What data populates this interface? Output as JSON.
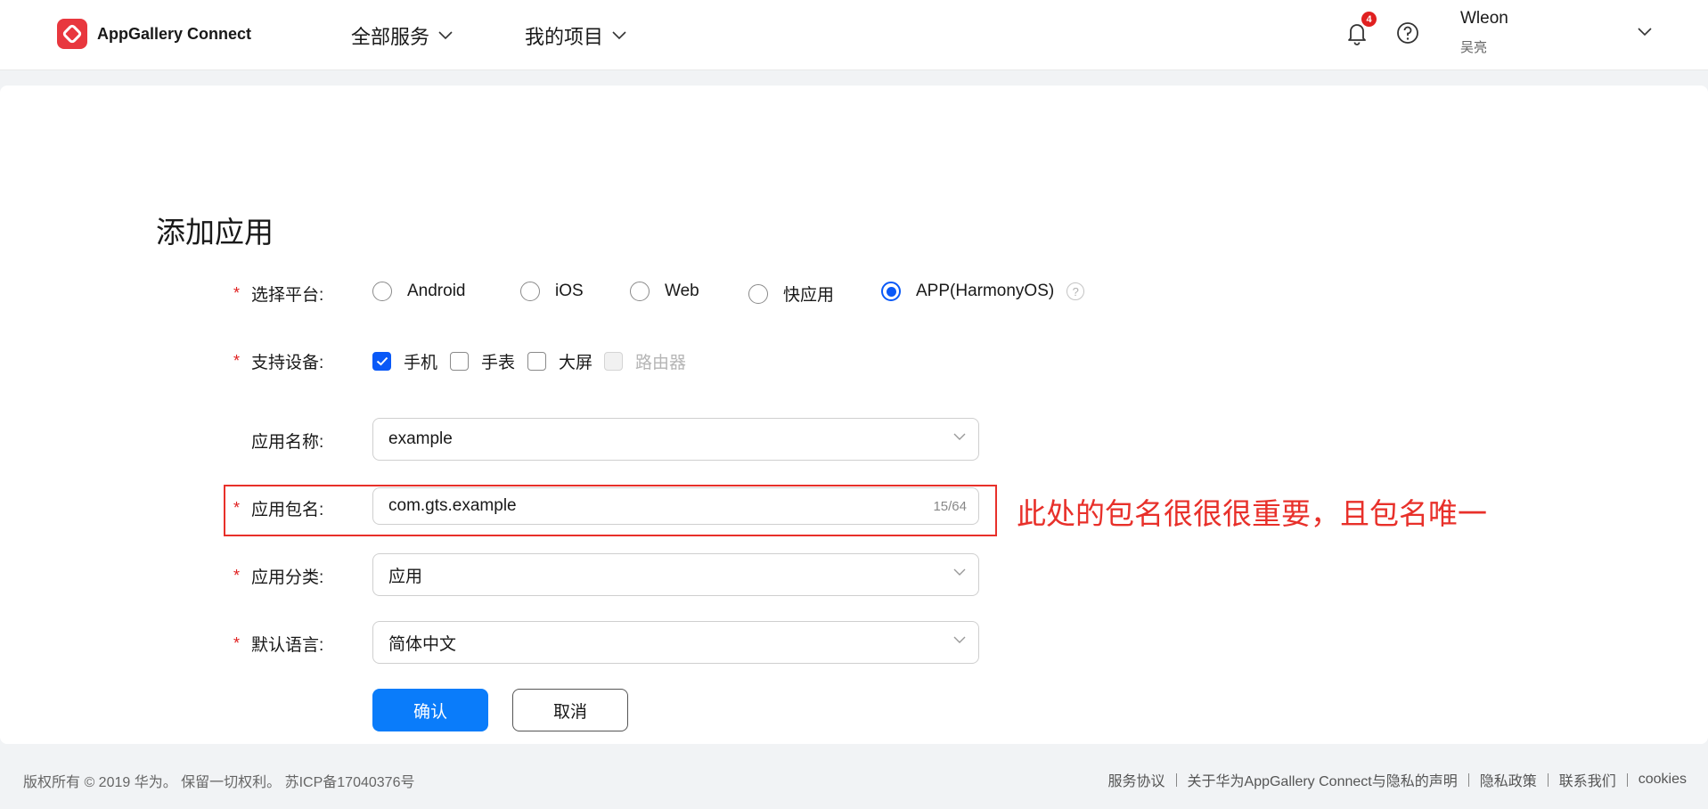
{
  "header": {
    "brand": "AppGallery Connect",
    "nav": [
      {
        "label": "全部服务"
      },
      {
        "label": "我的项目"
      }
    ],
    "notification_count": "4",
    "user": {
      "name": "Wleon",
      "sub": "吴亮"
    }
  },
  "form": {
    "title": "添加应用",
    "platform": {
      "label": "选择平台:",
      "options": [
        "Android",
        "iOS",
        "Web",
        "快应用",
        "APP(HarmonyOS)"
      ],
      "selected": "APP(HarmonyOS)"
    },
    "devices": {
      "label": "支持设备:",
      "options": [
        {
          "label": "手机",
          "checked": true,
          "disabled": false
        },
        {
          "label": "手表",
          "checked": false,
          "disabled": false
        },
        {
          "label": "大屏",
          "checked": false,
          "disabled": false
        },
        {
          "label": "路由器",
          "checked": false,
          "disabled": true
        }
      ]
    },
    "app_name": {
      "label": "应用名称:",
      "value": "example"
    },
    "package_name": {
      "label": "应用包名:",
      "value": "com.gts.example",
      "counter": "15/64"
    },
    "category": {
      "label": "应用分类:",
      "value": "应用"
    },
    "language": {
      "label": "默认语言:",
      "value": "简体中文"
    },
    "confirm_label": "确认",
    "cancel_label": "取消"
  },
  "annotation": "此处的包名很很很重要，且包名唯一",
  "colors": {
    "accent": "#0a59f7",
    "button": "#0a7cfa",
    "required": "#e02020",
    "annotation": "#e8302a"
  },
  "footer": {
    "copyright": "版权所有 © 2019 华为。 保留一切权利。 苏ICP备17040376号",
    "links": [
      "服务协议",
      "关于华为AppGallery Connect与隐私的声明",
      "隐私政策",
      "联系我们",
      "cookies"
    ]
  }
}
